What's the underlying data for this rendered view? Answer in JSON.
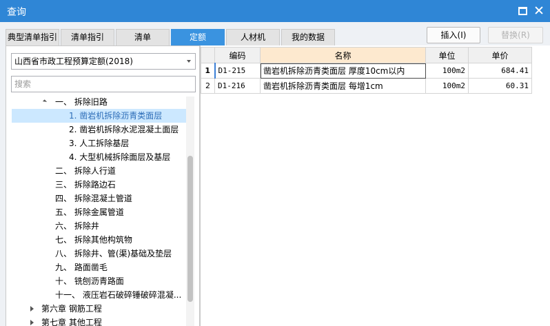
{
  "window": {
    "title": "查询"
  },
  "tabs": [
    {
      "label": "典型清单指引",
      "active": false
    },
    {
      "label": "清单指引",
      "active": false
    },
    {
      "label": "清单",
      "active": false
    },
    {
      "label": "定额",
      "active": true
    },
    {
      "label": "人材机",
      "active": false
    },
    {
      "label": "我的数据",
      "active": false
    }
  ],
  "actions": {
    "insert": "插入(I)",
    "replace": "替换(R)"
  },
  "left": {
    "quota_library": "山西省市政工程预算定额(2018)",
    "search_placeholder": "搜索",
    "tree": [
      {
        "text": "一、 拆除旧路",
        "expanded": true
      },
      {
        "text": "1. 凿岩机拆除沥青类面层",
        "selected": true
      },
      {
        "text": "2. 凿岩机拆除水泥混凝土面层"
      },
      {
        "text": "3. 人工拆除基层"
      },
      {
        "text": "4. 大型机械拆除面层及基层"
      },
      {
        "text": "二、 拆除人行道"
      },
      {
        "text": "三、 拆除路边石"
      },
      {
        "text": "四、 拆除混凝土管道"
      },
      {
        "text": "五、 拆除金属管道"
      },
      {
        "text": "六、 拆除井"
      },
      {
        "text": "七、 拆除其他构筑物"
      },
      {
        "text": "八、 拆除井、管(渠)基础及垫层"
      },
      {
        "text": "九、 路面凿毛"
      },
      {
        "text": "十、 铣刨沥青路面"
      },
      {
        "text": "十一、 液压岩石破碎锤破碎混凝..."
      },
      {
        "text": "第六章 钢筋工程",
        "collapsed": true
      },
      {
        "text": "第七章 其他工程",
        "collapsed": true
      }
    ]
  },
  "table": {
    "columns": [
      "编码",
      "名称",
      "单位",
      "单价"
    ],
    "rows": [
      {
        "num": "1",
        "code": "D1-215",
        "name": "凿岩机拆除沥青类面层 厚度10cm以内",
        "unit": "100m2",
        "price": "684.41"
      },
      {
        "num": "2",
        "code": "D1-216",
        "name": "凿岩机拆除沥青类面层 每增1cm",
        "unit": "100m2",
        "price": "60.31"
      }
    ]
  },
  "colors": {
    "titlebar": "#2f86d6",
    "active_tab": "#3a93e0",
    "selected_tree": "#cce8ff",
    "sorted_header": "#fde9cf"
  }
}
